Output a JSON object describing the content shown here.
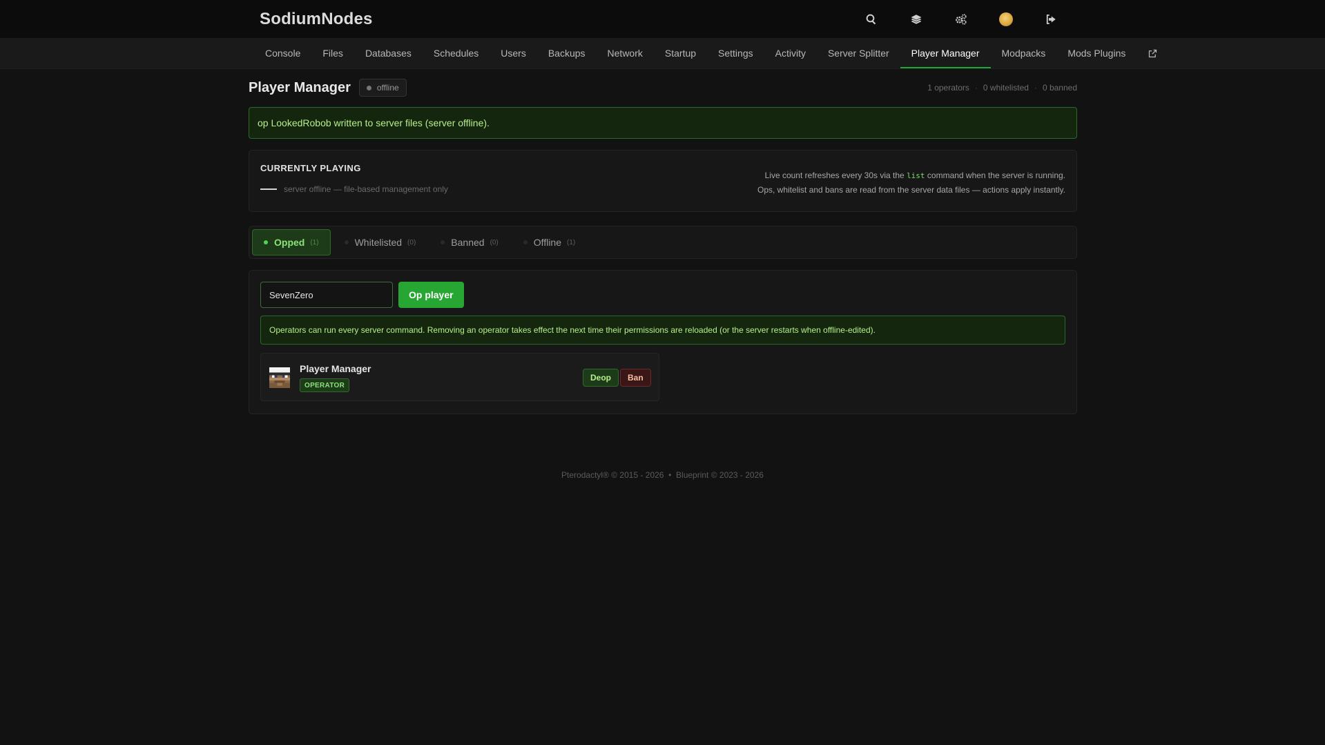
{
  "brand": "SodiumNodes",
  "nav": {
    "items": [
      "Console",
      "Files",
      "Databases",
      "Schedules",
      "Users",
      "Backups",
      "Network",
      "Startup",
      "Settings",
      "Activity",
      "Server Splitter",
      "Player Manager",
      "Modpacks",
      "Mods Plugins"
    ],
    "active": "Player Manager"
  },
  "page": {
    "title": "Player Manager",
    "status": "offline",
    "counts": [
      "1 operators",
      "0 whitelisted",
      "0 banned"
    ],
    "count_separator": "·"
  },
  "notice": "op LookedRobob written to server files (server offline).",
  "playing": {
    "title": "CURRENTLY PLAYING",
    "status": "server offline — file-based management only",
    "info_line1_pre": "Live count refreshes every 30s via the ",
    "info_line1_code": "list",
    "info_line1_post": " command when the server is running.",
    "info_line2": "Ops, whitelist and bans are read from the server data files — actions apply instantly."
  },
  "tabs": [
    {
      "label": "Opped",
      "count": "(1)"
    },
    {
      "label": "Whitelisted",
      "count": "(0)"
    },
    {
      "label": "Banned",
      "count": "(0)"
    },
    {
      "label": "Offline",
      "count": "(1)"
    }
  ],
  "form": {
    "input_value": "SevenZero",
    "button": "Op player"
  },
  "panel_note": "Operators can run every server command. Removing an operator takes effect the next time their permissions are reloaded (or the server restarts when offline-edited).",
  "player": {
    "name": "Player Manager",
    "tag": "OPERATOR",
    "deop": "Deop",
    "ban": "Ban"
  },
  "footer": "Pterodactyl® © 2015 - 2026  •  Blueprint © 2023 - 2026",
  "colors": {
    "accent": "#27a633",
    "active_tab_text": "#8ce37a",
    "danger": "#6a2b2b"
  },
  "icons": [
    "search-icon",
    "layers-icon",
    "cogs-icon",
    "avatar-icon",
    "logout-icon",
    "external-link-icon"
  ]
}
